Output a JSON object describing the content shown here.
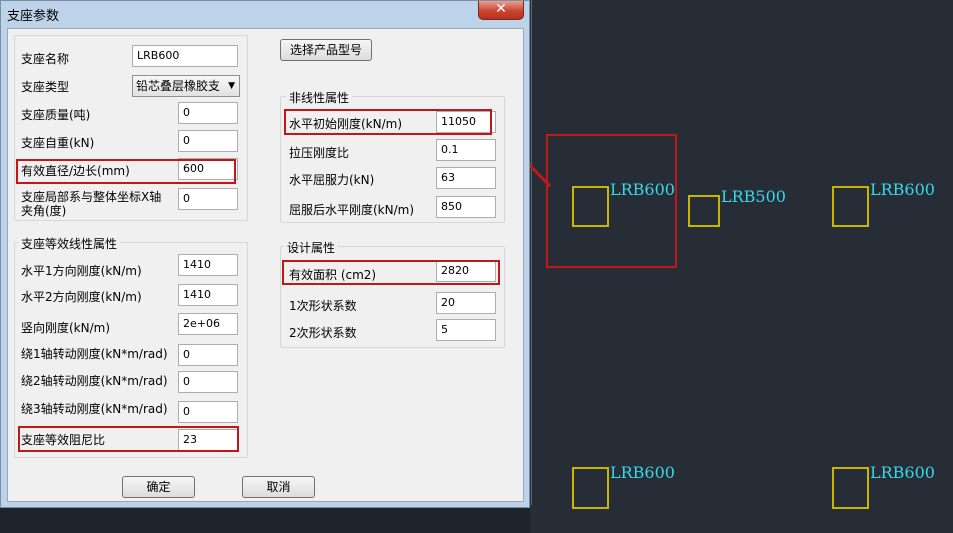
{
  "dialog": {
    "title": "支座参数",
    "close_glyph": "✕",
    "select_product_button": "选择产品型号",
    "ok_button": "确定",
    "cancel_button": "取消"
  },
  "basic": {
    "name_label": "支座名称",
    "name_value": "LRB600",
    "type_label": "支座类型",
    "type_value": "铅芯叠层橡胶支",
    "mass_label": "支座质量(吨)",
    "mass_value": "0",
    "weight_label": "支座自重(kN)",
    "weight_value": "0",
    "diameter_label": "有效直径/边长(mm)",
    "diameter_value": "600",
    "angle_label_line1": "支座局部系与整体坐标X轴",
    "angle_label_line2": "夹角(度)",
    "angle_value": "0"
  },
  "linear": {
    "group_title": "支座等效线性属性",
    "h1_label": "水平1方向刚度(kN/m)",
    "h1_value": "1410",
    "h2_label": "水平2方向刚度(kN/m)",
    "h2_value": "1410",
    "v_label": "竖向刚度(kN/m)",
    "v_value": "2e+06",
    "r1_label": "绕1轴转动刚度(kN*m/rad)",
    "r1_value": "0",
    "r2_label": "绕2轴转动刚度(kN*m/rad)",
    "r2_value": "0",
    "r3_label": "绕3轴转动刚度(kN*m/rad)",
    "r3_value": "0",
    "damping_label": "支座等效阻尼比",
    "damping_value": "23"
  },
  "nonlinear": {
    "group_title": "非线性属性",
    "k0_label": "水平初始刚度(kN/m)",
    "k0_value": "11050",
    "tension_label": "拉压刚度比",
    "tension_value": "0.1",
    "yield_label": "水平屈服力(kN)",
    "yield_value": "63",
    "post_label": "屈服后水平刚度(kN/m)",
    "post_value": "850"
  },
  "design": {
    "group_title": "设计属性",
    "area_label": "有效面积 (cm2)",
    "area_value": "2820",
    "s1_label": "1次形状系数",
    "s1_value": "20",
    "s2_label": "2次形状系数",
    "s2_value": "5"
  },
  "cad": {
    "labels": [
      "LRB600",
      "LRB500",
      "LRB600",
      "LRB600",
      "LRB600"
    ]
  },
  "colors": {
    "highlight": "#c01818",
    "support_box": "#c9b600",
    "support_label": "#38d7e6"
  }
}
